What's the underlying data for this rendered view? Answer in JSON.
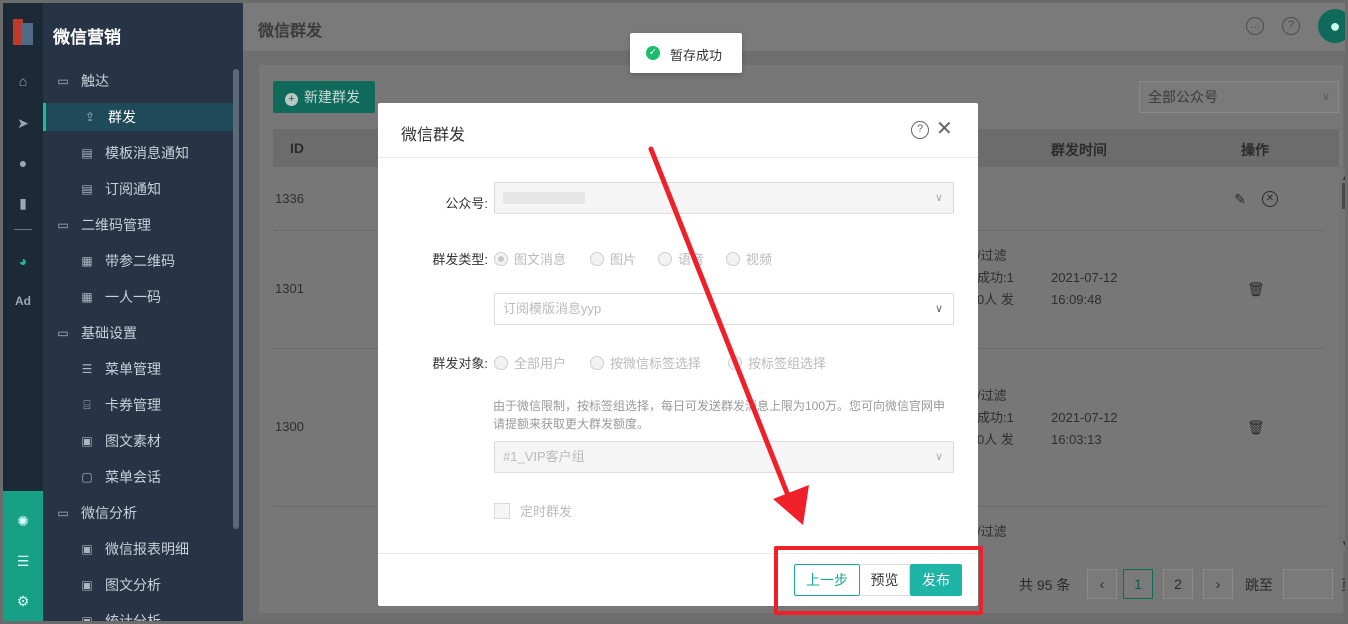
{
  "sidebar": {
    "brand": "微信营销",
    "items": [
      {
        "label": "触达",
        "icon": "folder-icon",
        "type": "group"
      },
      {
        "label": "群发",
        "icon": "broadcast-icon",
        "type": "child",
        "active": true
      },
      {
        "label": "模板消息通知",
        "icon": "template-icon",
        "type": "child"
      },
      {
        "label": "订阅通知",
        "icon": "subscribe-icon",
        "type": "child"
      },
      {
        "label": "二维码管理",
        "icon": "folder-icon",
        "type": "group"
      },
      {
        "label": "带参二维码",
        "icon": "qrcode-icon",
        "type": "child"
      },
      {
        "label": "一人一码",
        "icon": "qrcode-icon",
        "type": "child"
      },
      {
        "label": "基础设置",
        "icon": "folder-icon",
        "type": "group"
      },
      {
        "label": "菜单管理",
        "icon": "menu-list-icon",
        "type": "child"
      },
      {
        "label": "卡券管理",
        "icon": "coupon-icon",
        "type": "child"
      },
      {
        "label": "图文素材",
        "icon": "article-icon",
        "type": "child"
      },
      {
        "label": "菜单会话",
        "icon": "chat-icon",
        "type": "child"
      },
      {
        "label": "微信分析",
        "icon": "folder-icon",
        "type": "group"
      },
      {
        "label": "微信报表明细",
        "icon": "report-icon",
        "type": "child"
      },
      {
        "label": "图文分析",
        "icon": "report-icon",
        "type": "child"
      },
      {
        "label": "统计分析",
        "icon": "report-icon",
        "type": "child"
      }
    ]
  },
  "rail": {
    "items": [
      "home-icon",
      "send-icon",
      "user-icon",
      "bar-chart-icon",
      "wechat-icon",
      "ad-icon"
    ],
    "ad_label": "Ad",
    "bottom": [
      "network-icon",
      "server-icon",
      "settings-icon"
    ]
  },
  "header": {
    "title": "微信群发",
    "icons": [
      "message-icon",
      "help-icon"
    ]
  },
  "toolbar": {
    "new_label": "新建群发",
    "account_select": "全部公众号"
  },
  "table": {
    "columns": {
      "id": "ID",
      "time": "群发时间",
      "action": "操作"
    },
    "rows": [
      {
        "id": "1336",
        "status": [
          "",
          "",
          ""
        ],
        "date": "",
        "time": ""
      },
      {
        "id": "1301",
        "status": [
          "/过滤",
          "成功:1",
          "0人 发"
        ],
        "date": "2021-07-12",
        "time": "16:09:48"
      },
      {
        "id": "1300",
        "status": [
          "/过滤",
          "成功:1",
          "0人 发"
        ],
        "date": "2021-07-12",
        "time": "16:03:13"
      },
      {
        "id": "",
        "status": [
          "/过滤",
          "",
          ""
        ],
        "date": "",
        "time": ""
      }
    ]
  },
  "pagination": {
    "total": "共 95 条",
    "pages": [
      "1",
      "2"
    ],
    "current": "1",
    "jump_label": "跳至",
    "page_suffix": "页"
  },
  "toast": {
    "message": "暂存成功"
  },
  "modal": {
    "title": "微信群发",
    "account_label": "公众号:",
    "type_label": "群发类型:",
    "types": [
      "图文消息",
      "图片",
      "语音",
      "视频"
    ],
    "template_select": "订阅模版消息yyp",
    "target_label": "群发对象:",
    "targets": [
      "全部用户",
      "按微信标签选择",
      "按标签组选择"
    ],
    "note": "由于微信限制，按标签组选择，每日可发送群发消息上限为100万。您可向微信官网申请提额来获取更大群发额度。",
    "group_select": "#1_VIP客户组",
    "schedule_label": "定时群发",
    "buttons": {
      "prev": "上一步",
      "preview": "预览",
      "publish": "发布"
    }
  },
  "colors": {
    "accent": "#1fb5a6",
    "annotation": "#f0202a",
    "success": "#19be6b"
  }
}
